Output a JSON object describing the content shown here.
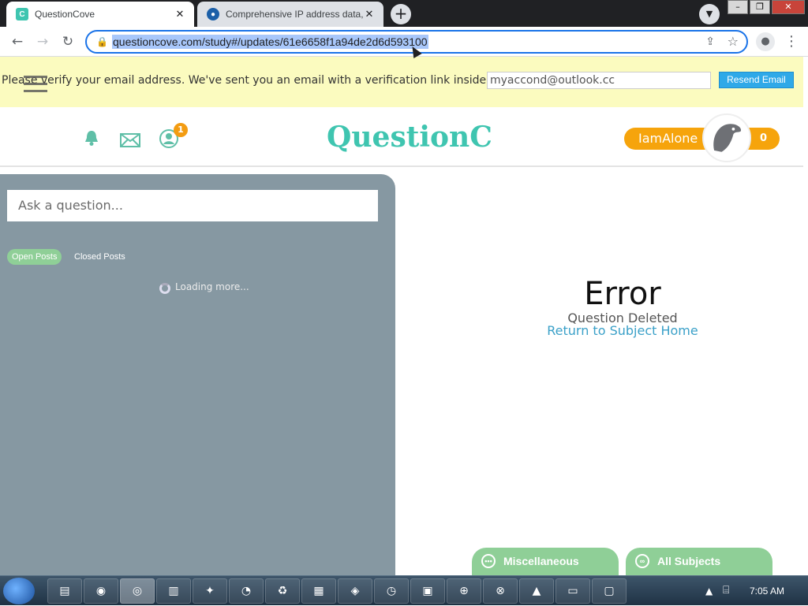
{
  "browser": {
    "tabs": [
      {
        "title": "QuestionCove",
        "favicon": "questioncove-favicon",
        "active": true
      },
      {
        "title": "Comprehensive IP address data, I",
        "favicon": "ipinfo-favicon",
        "active": false
      }
    ],
    "url": "questioncove.com/study#/updates/61e6658f1a94de2d6d593100"
  },
  "banner": {
    "message": "Please verify your email address. We've sent you an email with a verification link inside.",
    "email_value": "myaccond@outlook.cc",
    "resend_label": "Resend Email"
  },
  "header": {
    "logo_text": "QuestionCove",
    "notification_badge": "1",
    "username": "IamAlone",
    "score": "0"
  },
  "left_panel": {
    "ask_placeholder": "Ask a question...",
    "filters": {
      "open": "Open Posts",
      "closed": "Closed Posts"
    },
    "loading_text": "Loading more..."
  },
  "main": {
    "error_title": "Error",
    "error_subtitle": "Question Deleted",
    "return_link": "Return to Subject Home"
  },
  "bottom_tabs": {
    "misc": "Miscellaneous",
    "all": "All Subjects"
  },
  "taskbar": {
    "clock": "7:05 AM"
  },
  "colors": {
    "brand_teal": "#3fc5b0",
    "accent_orange": "#f6a40c",
    "banner_yellow": "#fbfbbf",
    "panel_gray": "#8698a2",
    "green_pill": "#8fcf97",
    "link_blue": "#3aa0c8"
  }
}
